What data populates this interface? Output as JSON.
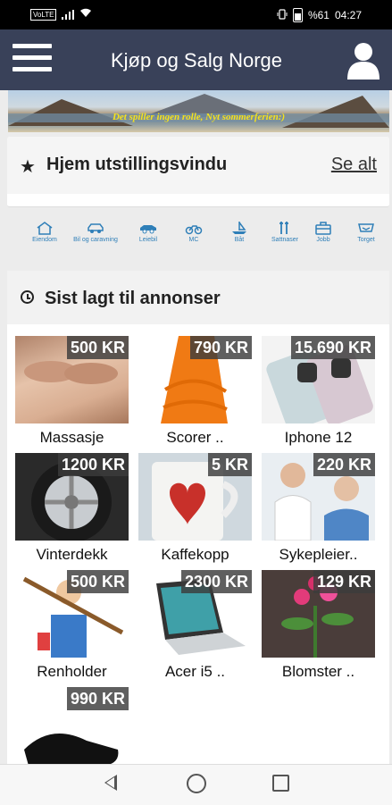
{
  "status_bar": {
    "left_badge": "VoLTE",
    "battery_percent": "%61",
    "time": "04:27"
  },
  "header": {
    "title": "Kjøp og Salg Norge"
  },
  "banner": {
    "text": "Det spiller ingen rolle, Nyt sommerferien:)"
  },
  "showcase": {
    "title": "Hjem utstillingsvindu",
    "see_all": "Se alt"
  },
  "categories": [
    {
      "label": "Eiendom",
      "icon": "house-icon"
    },
    {
      "label": "Bil og caravning",
      "icon": "car-icon"
    },
    {
      "label": "Leiebil",
      "icon": "rental-car-icon"
    },
    {
      "label": "MC",
      "icon": "motorcycle-icon"
    },
    {
      "label": "Båt",
      "icon": "boat-icon"
    },
    {
      "label": "Sattnaser",
      "icon": "tools-icon"
    },
    {
      "label": "Jobb",
      "icon": "briefcase-icon"
    },
    {
      "label": "Torget",
      "icon": "market-icon"
    }
  ],
  "recent": {
    "title": "Sist lagt til annonser",
    "ads": [
      {
        "title": "Massasje",
        "price": "500 KR"
      },
      {
        "title": "Scorer ..",
        "price": "790 KR"
      },
      {
        "title": "Iphone 12",
        "price": "15.690 KR"
      },
      {
        "title": "Vinterdekk",
        "price": "1200 KR"
      },
      {
        "title": "Kaffekopp",
        "price": "5 KR"
      },
      {
        "title": "Sykepleier..",
        "price": "220 KR"
      },
      {
        "title": "Renholder",
        "price": "500 KR"
      },
      {
        "title": "Acer i5 ..",
        "price": "2300 KR"
      },
      {
        "title": "Blomster ..",
        "price": "129 KR"
      },
      {
        "title": "",
        "price": "990 KR"
      }
    ]
  }
}
